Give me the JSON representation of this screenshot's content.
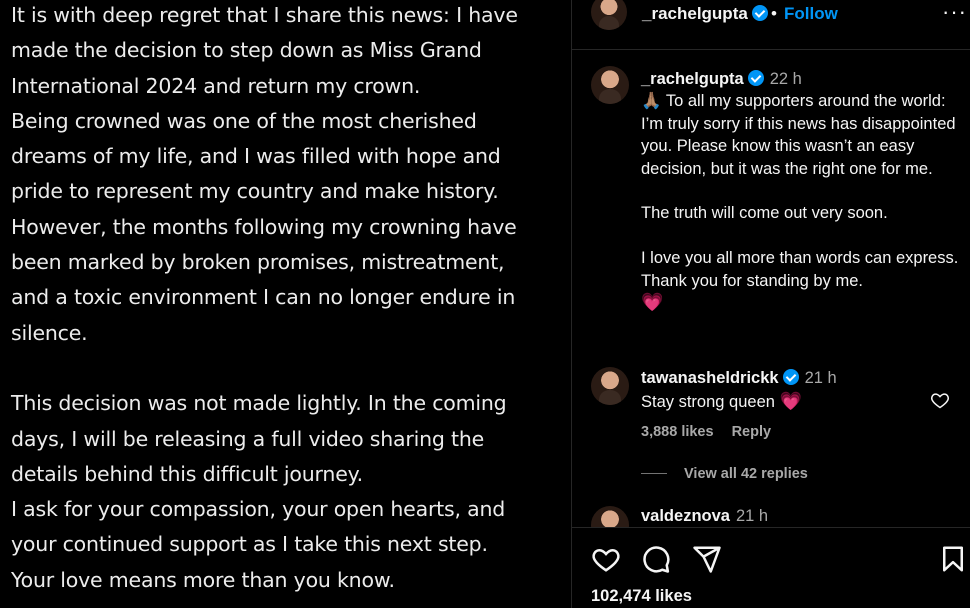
{
  "post_image": {
    "lines_a": [
      "It is with deep regret that I share this news: I have",
      "made the decision to step down as Miss Grand",
      "International 2024 and return my crown.",
      "Being crowned was one of the most cherished",
      "dreams of my life, and I was filled with hope and",
      "pride to represent my country and make history.",
      "However, the months following my crowning have",
      "been marked by broken promises, mistreatment,",
      "and a toxic environment I can no longer endure in",
      "silence."
    ],
    "lines_b": [
      "This decision was not made lightly. In the coming",
      "days, I will be releasing a full video sharing the",
      "details behind this difficult journey.",
      "I ask for your compassion, your open hearts, and",
      "your continued support as I take this next step.",
      "Your love means more than you know."
    ]
  },
  "header": {
    "username": "_rachelgupta",
    "separator": "•",
    "follow_label": "Follow",
    "more_glyph": "···"
  },
  "caption": {
    "username": "_rachelgupta",
    "time": "22 h",
    "emoji_pray": "🙏🏽",
    "para1": "To all my supporters around the world: I’m truly sorry if this news has disappointed you. Please know this wasn’t an easy decision, but it was the right one for me.",
    "para2": "The truth will come out very soon.",
    "para3": "I love you all more than words can express. Thank you for standing by me.",
    "emoji_heart": "💗"
  },
  "comment1": {
    "username": "tawanasheldrickk",
    "time": "21 h",
    "text": "Stay strong queen",
    "emoji": "💗",
    "likes": "3,888 likes",
    "reply_label": "Reply",
    "view_replies": "View all 42 replies"
  },
  "comment2": {
    "username": "valdeznova",
    "time": "21 h"
  },
  "actions": {
    "likes": "102,474 likes",
    "icons": [
      "heart-icon",
      "comment-icon",
      "share-icon",
      "bookmark-icon"
    ]
  },
  "colors": {
    "background": "#000000",
    "text": "#f5f5f5",
    "secondary": "#a8a8a8",
    "accent": "#0095f6",
    "heart": "#ef3d7b"
  }
}
